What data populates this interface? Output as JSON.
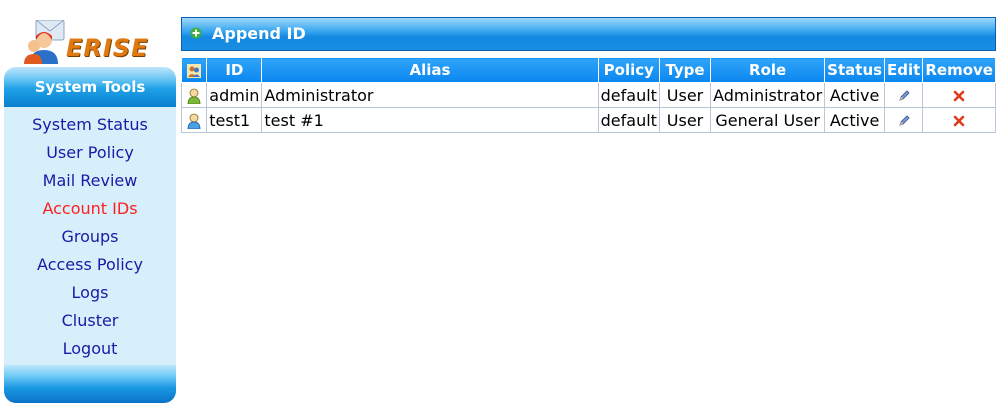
{
  "logo": {
    "text": "ERISE"
  },
  "sidebar": {
    "title": "System Tools",
    "items": [
      {
        "label": "System Status",
        "active": false
      },
      {
        "label": "User Policy",
        "active": false
      },
      {
        "label": "Mail Review",
        "active": false
      },
      {
        "label": "Account IDs",
        "active": true
      },
      {
        "label": "Groups",
        "active": false
      },
      {
        "label": "Access Policy",
        "active": false
      },
      {
        "label": "Logs",
        "active": false
      },
      {
        "label": "Cluster",
        "active": false
      },
      {
        "label": "Logout",
        "active": false
      }
    ]
  },
  "main": {
    "append_label": "Append ID",
    "table": {
      "headers": [
        "ID",
        "Alias",
        "Policy",
        "Type",
        "Role",
        "Status",
        "Edit",
        "Remove"
      ],
      "rows": [
        {
          "id": "admin",
          "alias": "Administrator",
          "policy": "default",
          "type": "User",
          "role": "Administrator",
          "status": "Active",
          "icon_color": "#7ab83a"
        },
        {
          "id": "test1",
          "alias": "test #1",
          "policy": "default",
          "type": "User",
          "role": "General User",
          "status": "Active",
          "icon_color": "#4aa0e6"
        }
      ]
    }
  },
  "colors": {
    "active_link": "#ff2020",
    "link": "#1a1aa6",
    "header_blue": "#0a86f0"
  }
}
